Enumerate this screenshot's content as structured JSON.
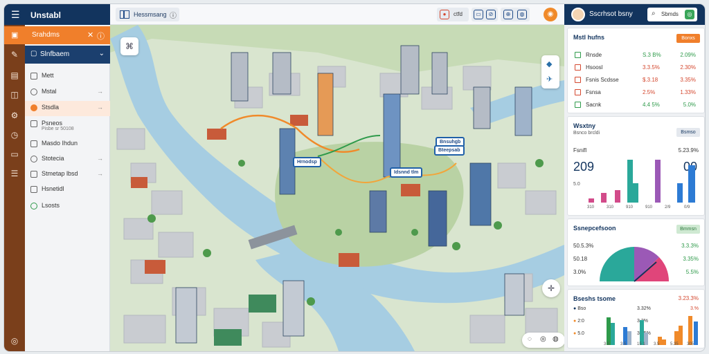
{
  "app": {
    "title": "Unstabl"
  },
  "sidebar": {
    "section_orange": "Srahdms",
    "section_navy": "Slnfbaem",
    "items": [
      {
        "label": "Mett",
        "sub": ""
      },
      {
        "label": "Mstal",
        "sub": ""
      },
      {
        "label": "Stsdla",
        "sub": ""
      },
      {
        "label": "Psneos",
        "sub": "Pisbe sr 50108"
      },
      {
        "label": "Masdo Ihdun",
        "sub": ""
      },
      {
        "label": "Stotecia",
        "sub": ""
      },
      {
        "label": "Stmetap lbsd",
        "sub": ""
      },
      {
        "label": "Hsnetidl",
        "sub": ""
      },
      {
        "label": "Lsosts",
        "sub": ""
      }
    ]
  },
  "topbar": {
    "map_title": "Hessmsang",
    "group1_text": "ctfd",
    "tools": [
      "⊕",
      "⊘",
      "⊕"
    ]
  },
  "user": {
    "name": "Sscrhsot bsny"
  },
  "search": {
    "placeholder": "Sbmds"
  },
  "map_labels": [
    {
      "text": "Hrnodsp"
    },
    {
      "text": "Idsnnd tlm"
    },
    {
      "text": "Bnsuhgb"
    },
    {
      "text": "Bteepsab"
    }
  ],
  "panel1": {
    "title": "Mstl hufns",
    "button": "Bonxs",
    "rows": [
      {
        "name": "Rnsde",
        "v1": "S.3 B%",
        "v2": "2.09%",
        "color": "#2e9a4a"
      },
      {
        "name": "Hsoosl",
        "v1": "3.3.5%",
        "v2": "2.30%",
        "color": "#d4472e"
      },
      {
        "name": "Fsnis Scdsse",
        "v1": "$.3.18",
        "v2": "3.35%",
        "color": "#d4472e"
      },
      {
        "name": "Fsnsa",
        "v1": "2.5%",
        "v2": "1.33%",
        "color": "#d4472e"
      },
      {
        "name": "Sacnk",
        "v1": "4.4 5%",
        "v2": "5.0%",
        "color": "#2e9a4a"
      }
    ]
  },
  "panel2": {
    "title": "Wsxtny",
    "subtitle": "Bsnco brcldi",
    "button": "Bsmso",
    "label": "Fsnifl",
    "pct": "5.23.9%",
    "big_left": "209",
    "big_right": "00",
    "small": "5.0",
    "axis": [
      "310",
      "310",
      "910",
      "910",
      "2/9",
      "0/9"
    ]
  },
  "panel3": {
    "title": "Ssnepcefsoon",
    "button": "Bmmsn",
    "left": [
      "50.5.3%",
      "50.18",
      "3.0%"
    ],
    "right": [
      "3.3.3%",
      "3.35%",
      "5.5%"
    ]
  },
  "panel4": {
    "title": "Bseshs tsome",
    "pct": "3.23.3%",
    "rows": [
      {
        "label": "Bso",
        "v": "3.32%",
        "v2": "3.%"
      },
      {
        "label": "2:0",
        "v": "3.3%",
        "v2": ""
      },
      {
        "label": "5.0",
        "v": "3.35%",
        "v2": ""
      }
    ],
    "axis": [
      "3 5",
      "3.5",
      "15 1",
      "3.5",
      "5.35",
      "305"
    ]
  },
  "colors": {
    "navy": "#12345e",
    "orange": "#f07f2b",
    "water": "#9fc8df",
    "green": "#2e9a4a",
    "red": "#d4472e"
  }
}
